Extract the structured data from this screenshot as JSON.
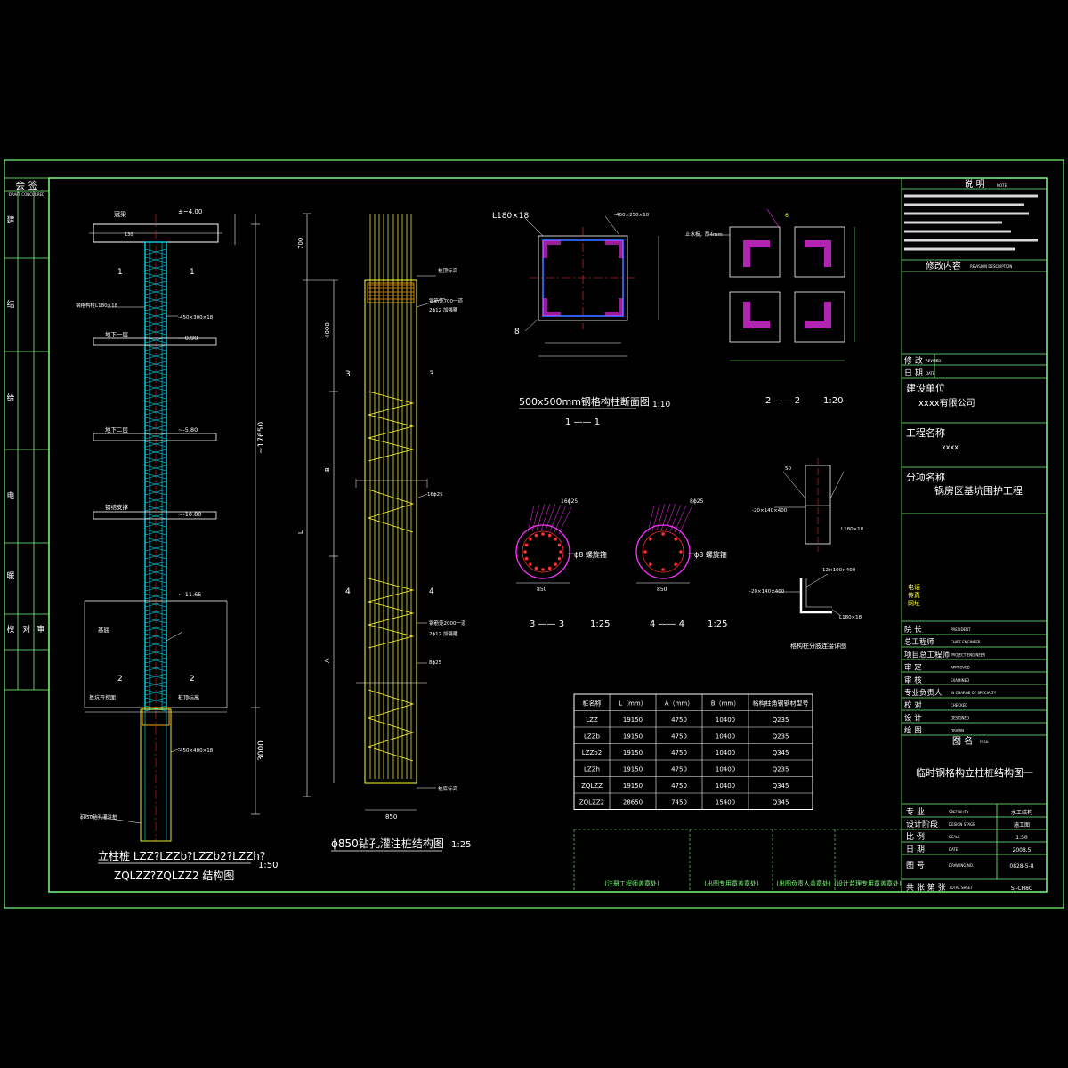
{
  "colors": {
    "background": "#000000",
    "frame": "#7CFC7C",
    "white": "#FFFFFF",
    "cyan": "#00E5FF",
    "yellow": "#FFFF33",
    "magenta": "#FF33FF",
    "red": "#FF3030",
    "blue": "#3366FF",
    "orange": "#FFAA00"
  },
  "left_strip": {
    "header": "会 签",
    "subheader": "DRAFT CONCURRED",
    "rows": [
      "建",
      "结",
      "给",
      "电",
      "暖"
    ],
    "headers2": [
      "校",
      "对",
      "审"
    ]
  },
  "column_drawing": {
    "top_labels": [
      "冠梁",
      "±~4.00",
      "130"
    ],
    "level_labels": [
      "钢格构柱L180×18",
      "-450×300×18",
      "地下一层",
      "~-0.90",
      "地下二层",
      "~-5.80",
      "钢结支撑",
      "~-10.80",
      "~-11.65",
      "基底",
      "基坑开挖面",
      "桩顶标高",
      "-450×400×18",
      "ϕ850钻孔灌注桩"
    ],
    "section_marks": [
      "1",
      "1",
      "2",
      "2"
    ],
    "dim_total": "~17650",
    "dim_bottom": "3000",
    "title": "立柱桩 LZZ?LZZb?LZZb2?LZZh?",
    "title2": "ZQLZZ?ZQLZZ2 结构图",
    "scale": "1:50"
  },
  "pile_drawing": {
    "labels": [
      "桩顶标高",
      "钢筋笼700一道",
      "2ϕ12 加强箍",
      "16ϕ25",
      "钢筋笼2000一道",
      "2ϕ12 加强箍",
      "8ϕ25",
      "桩底标高"
    ],
    "dims": [
      "700",
      "4000",
      "B",
      "L",
      "A",
      "850"
    ],
    "section_marks": [
      "3",
      "3",
      "4",
      "4"
    ],
    "title": "ϕ850钻孔灌注桩结构图",
    "scale": "1:25"
  },
  "section_11": {
    "labels": [
      "L180×18",
      "-400×250×10",
      "8"
    ],
    "title": "500x500mm钢格构柱断面图",
    "scale": "1:10",
    "mark": "1 —— 1"
  },
  "section_22": {
    "labels": [
      "止水板，厚4mm",
      "6"
    ],
    "mark": "2 —— 2",
    "scale": "1:20"
  },
  "section_33": {
    "labels": [
      "16ϕ25",
      "ϕ8 螺旋箍",
      "850"
    ],
    "mark": "3 —— 3",
    "scale": "1:25"
  },
  "section_44": {
    "labels": [
      "8ϕ25",
      "ϕ8 螺旋箍",
      "850"
    ],
    "mark": "4 —— 4",
    "scale": "1:25"
  },
  "detail": {
    "labels": [
      "50",
      "-20×140×400",
      "L180×18",
      "-12×100×400",
      "-20×140×400",
      "L180×18"
    ],
    "title": "格构柱分肢连接详图"
  },
  "table": {
    "headers": [
      "桩名称",
      "L（mm）",
      "A（mm）",
      "B（mm）",
      "格构柱角钢钢材型号"
    ],
    "rows": [
      [
        "LZZ",
        "19150",
        "4750",
        "10400",
        "Q235"
      ],
      [
        "LZZb",
        "19150",
        "4750",
        "10400",
        "Q235"
      ],
      [
        "LZZb2",
        "19150",
        "4750",
        "10400",
        "Q345"
      ],
      [
        "LZZh",
        "19150",
        "4750",
        "10400",
        "Q235"
      ],
      [
        "ZQLZZ",
        "19150",
        "4750",
        "10400",
        "Q345"
      ],
      [
        "ZQLZZ2",
        "28650",
        "7450",
        "15400",
        "Q345"
      ]
    ]
  },
  "stamps": [
    "(注册工程师盖章处)",
    "(出图专用章盖章处)",
    "(出图负责人盖章处)",
    "(设计监理专用章盖章处)"
  ],
  "title_block": {
    "notes_title": "说 明",
    "notes_en": "NOTE",
    "revision_title": "修改内容",
    "revision_en": "REVISION DESCRIPTION",
    "rev_fields": [
      "修 改",
      "日 期"
    ],
    "rev_fields_en": [
      "REVISED",
      "DATE"
    ],
    "client_label": "建设单位",
    "client": "xxxx有限公司",
    "project_label": "工程名称",
    "project": "xxxx",
    "subproject_label": "分项名称",
    "subproject": "锅房区基坑围护工程",
    "contact_labels": [
      "电话",
      "传真",
      "网址"
    ],
    "roles": [
      "院 长",
      "总工程师",
      "项目总工程师",
      "审 定",
      "审 核",
      "专业负责人",
      "校 对",
      "设 计",
      "绘 图"
    ],
    "roles_en": [
      "PRESIDENT",
      "CHIEF ENGINEER",
      "PROJECT ENGINEER",
      "APPROVED",
      "EXAMINED",
      "IN CHARGE OF SPECIALTY",
      "CHECKED",
      "DESIGNED",
      "DRAWN"
    ],
    "drawing_title_label": "图 名",
    "drawing_title_en": "TITLE",
    "drawing_title": "临时钢格构立柱桩结构图一",
    "meta_labels": [
      "专 业",
      "设计阶段",
      "比 例",
      "日 期",
      "图 号",
      "共 张 第 张"
    ],
    "meta_en": [
      "SPECIALITY",
      "DESIGN STAGE",
      "SCALE",
      "DATE",
      "DRAWING NO.",
      "TOTAL SHEET"
    ],
    "meta_values": [
      "水工结构",
      "施工图",
      "1:50",
      "2008.5",
      "0828-5-8",
      "SJ-CH8C"
    ]
  }
}
